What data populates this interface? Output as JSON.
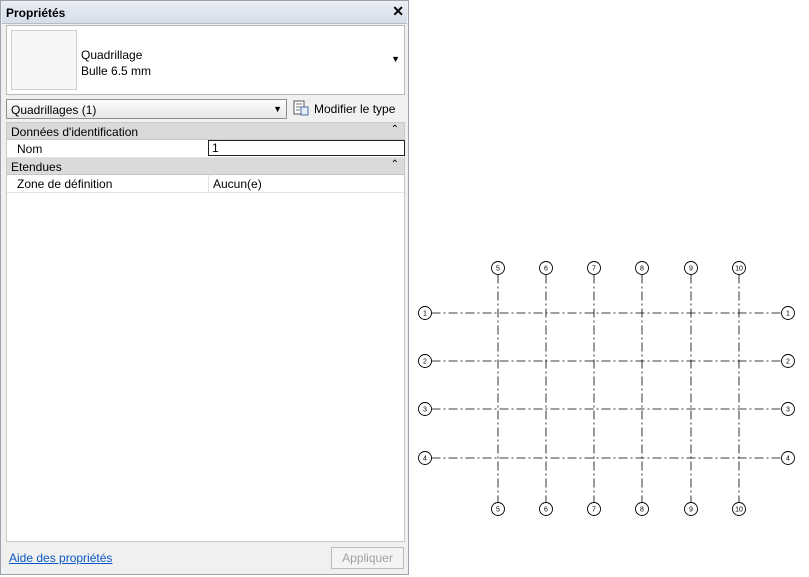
{
  "panel": {
    "title": "Propriétés",
    "close_glyph": "✕",
    "type_selector": {
      "name": "Quadrillage",
      "subtype": "Bulle 6.5 mm"
    },
    "filter_dropdown": "Quadrillages (1)",
    "edit_type_label": "Modifier le type",
    "groups": [
      {
        "label": "Données d'identification",
        "rows": [
          {
            "name": "Nom",
            "value": "1"
          }
        ]
      },
      {
        "label": "Etendues",
        "rows": [
          {
            "name": "Zone de définition",
            "value": "Aucun(e)"
          }
        ]
      }
    ],
    "help_link": "Aide des propriétés",
    "apply_button": "Appliquer"
  },
  "drawing": {
    "vertical_grids": [
      "5",
      "6",
      "7",
      "8",
      "9",
      "10"
    ],
    "horizontal_grids": [
      "1",
      "2",
      "3",
      "4"
    ]
  }
}
